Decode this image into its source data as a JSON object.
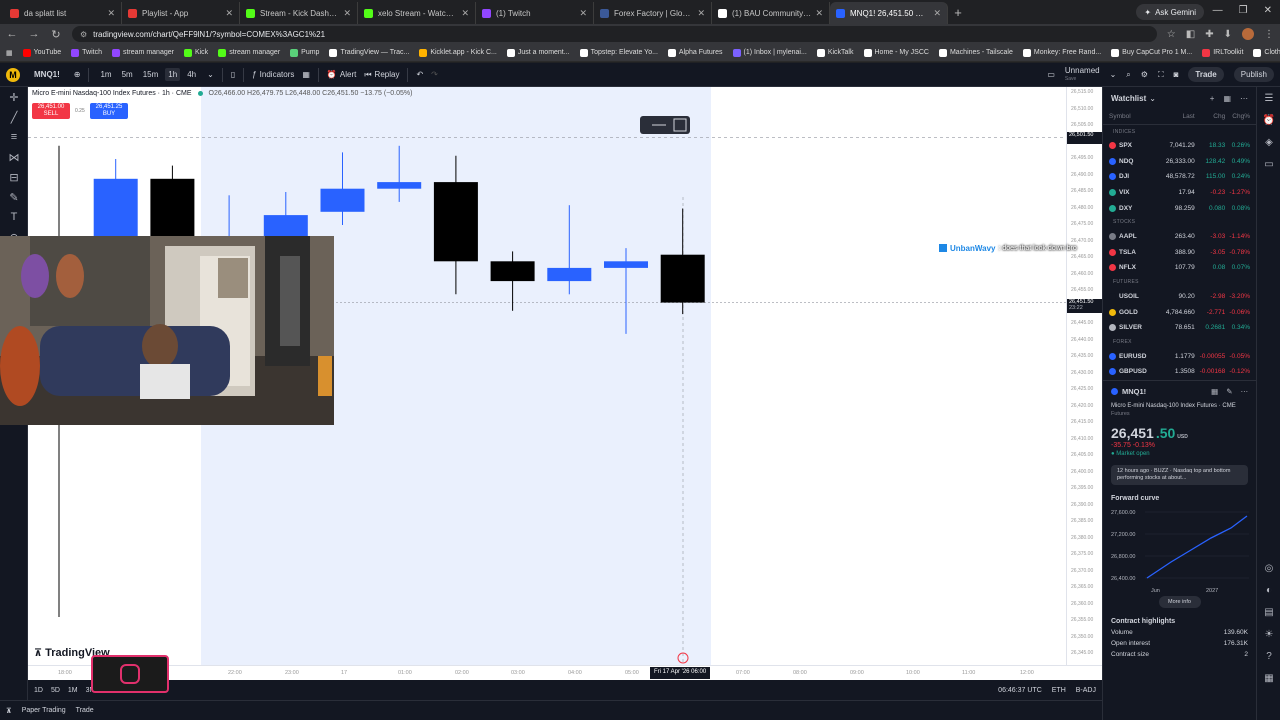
{
  "browser": {
    "tabs": [
      {
        "label": "da splatt list",
        "color": "#e53935",
        "active": false
      },
      {
        "label": "Playlist - App",
        "color": "#e53935",
        "active": false
      },
      {
        "label": "Stream - Kick Dashboard",
        "color": "#53fc18",
        "active": false
      },
      {
        "label": "xelo Stream - Watch Live on Ki",
        "color": "#53fc18",
        "active": false
      },
      {
        "label": "(1) Twitch",
        "color": "#9146ff",
        "active": false
      },
      {
        "label": "Forex Factory | Global markets",
        "color": "#3b5998",
        "active": false
      },
      {
        "label": "(1) BAU Community / X",
        "color": "#ffffff",
        "active": false
      },
      {
        "label": "MNQ1! 26,451.50 ▼ −0.13% U",
        "color": "#2962ff",
        "active": true
      }
    ],
    "new_tab": "+",
    "gemini_label": "Ask Gemini",
    "url": "tradingview.com/chart/QeFF9lN1/?symbol=COMEX%3AGC1%21",
    "bookmarks": [
      {
        "label": "YouTube",
        "color": "#ff0000"
      },
      {
        "label": "Twitch",
        "color": "#9146ff"
      },
      {
        "label": "stream manager",
        "color": "#9146ff"
      },
      {
        "label": "Kick",
        "color": "#53fc18"
      },
      {
        "label": "stream manager",
        "color": "#53fc18"
      },
      {
        "label": "Pump",
        "color": "#5ad07a"
      },
      {
        "label": "TradingView — Trac...",
        "color": "#ffffff"
      },
      {
        "label": "Kicklet.app - Kick C...",
        "color": "#ffb300"
      },
      {
        "label": "Just a moment...",
        "color": "#ffffff"
      },
      {
        "label": "Topstep: Elevate Yo...",
        "color": "#ffffff"
      },
      {
        "label": "Alpha Futures",
        "color": "#ffffff"
      },
      {
        "label": "(1) Inbox | mylenai...",
        "color": "#7b61ff"
      },
      {
        "label": "KickTalk",
        "color": "#ffffff"
      },
      {
        "label": "Home - My JSCC",
        "color": "#ffffff"
      },
      {
        "label": "Machines - Tailscale",
        "color": "#ffffff"
      },
      {
        "label": "Monkey: Free Rand...",
        "color": "#ffffff"
      },
      {
        "label": "Buy CapCut Pro 1 M...",
        "color": "#ffffff"
      },
      {
        "label": "IRLToolkit",
        "color": "#f23645"
      },
      {
        "label": "Clothing Preview | D...",
        "color": "#ffffff"
      }
    ]
  },
  "tv": {
    "symbol": "MNQ1!",
    "timeframes": [
      "1m",
      "5m",
      "15m",
      "1h",
      "4h"
    ],
    "active_tf": "1h",
    "indicators": "Indicators",
    "alert": "Alert",
    "replay": "Replay",
    "layout_name": "Unnamed",
    "layout_sub": "Save",
    "trade": "Trade",
    "publish": "Publish"
  },
  "chart": {
    "title": "Micro E-mini Nasdaq-100 Index Futures · 1h · CME",
    "ohlc": "O26,466.00 H26,479.75 L26,448.00 C26,451.50 −13.75 (−0.05%)",
    "sell_price": "26,451.00",
    "sell_label": "SELL",
    "buy_price": "26,451.25",
    "buy_label": "BUY",
    "spread": "0.25",
    "watermark": "TradingView",
    "price_labels": [
      "26,515.00",
      "26,510.00",
      "26,505.00",
      "26,500.00",
      "26,495.00",
      "26,490.00",
      "26,485.00",
      "26,480.00",
      "26,475.00",
      "26,470.00",
      "26,465.00",
      "26,460.00",
      "26,455.00",
      "26,450.00",
      "26,445.00",
      "26,440.00",
      "26,435.00",
      "26,430.00",
      "26,425.00",
      "26,420.00",
      "26,415.00",
      "26,410.00",
      "26,405.00",
      "26,400.00",
      "26,395.00",
      "26,390.00",
      "26,385.00",
      "26,380.00",
      "26,375.00",
      "26,370.00",
      "26,365.00",
      "26,360.00",
      "26,355.00",
      "26,350.00",
      "26,345.00",
      "26,340.00"
    ],
    "crosshair_price": "26,501.50",
    "last_price": "26,451.50",
    "countdown": "23:22",
    "time_labels": [
      "18:00",
      "22:00",
      "23:00",
      "17",
      "01:00",
      "02:00",
      "03:00",
      "04:00",
      "05:00",
      "07:00",
      "08:00",
      "09:00",
      "10:00",
      "11:00",
      "12:00"
    ],
    "time_cursor": "Fri 17 Apr '26  06:00",
    "candles": [
      {
        "o": 26463,
        "h": 26499,
        "l": 26338,
        "c": 26465,
        "visible_low": false
      },
      {
        "o": 26463,
        "h": 26495,
        "l": 26463,
        "c": 26489,
        "color": "blue"
      },
      {
        "o": 26489,
        "h": 26493,
        "l": 26463,
        "c": 26463,
        "color": "black"
      },
      {
        "o": 26466,
        "h": 26484,
        "l": 26466,
        "c": 26470,
        "color": "blue"
      },
      {
        "o": 26470,
        "h": 26485,
        "l": 26466,
        "c": 26478,
        "color": "blue"
      },
      {
        "o": 26479,
        "h": 26497,
        "l": 26475,
        "c": 26486,
        "color": "blue"
      },
      {
        "o": 26486,
        "h": 26499,
        "l": 26482,
        "c": 26488,
        "color": "blue"
      },
      {
        "o": 26488,
        "h": 26496,
        "l": 26454,
        "c": 26464,
        "color": "black"
      },
      {
        "o": 26464,
        "h": 26467,
        "l": 26449,
        "c": 26458,
        "color": "black"
      },
      {
        "o": 26458,
        "h": 26481,
        "l": 26454,
        "c": 26462,
        "color": "blue"
      },
      {
        "o": 26462,
        "h": 26468,
        "l": 26442,
        "c": 26464,
        "color": "blue"
      },
      {
        "o": 26466,
        "h": 26480,
        "l": 26448,
        "c": 26451.5,
        "color": "black"
      }
    ],
    "chat_user": "UnbanWavy",
    "chat_msg": ": does that look down bro"
  },
  "bottom": {
    "ranges": [
      "1D",
      "5D",
      "1M",
      "3M"
    ],
    "clock": "06:46:37 UTC",
    "session": "ETH",
    "adj": "B-ADJ"
  },
  "footer": {
    "paper": "Paper Trading",
    "trade": "Trade"
  },
  "watchlist": {
    "title": "Watchlist",
    "cols": [
      "Symbol",
      "Last",
      "Chg",
      "Chg%"
    ],
    "sections": [
      {
        "name": "INDICES",
        "rows": [
          {
            "sym": "SPX",
            "last": "7,041.29",
            "chg": "18.33",
            "pct": "0.26%",
            "dir": "pos",
            "dot": "#f23645"
          },
          {
            "sym": "NDQ",
            "last": "26,333.00",
            "chg": "128.42",
            "pct": "0.49%",
            "dir": "pos",
            "dot": "#2962ff"
          },
          {
            "sym": "DJI",
            "last": "48,578.72",
            "chg": "115.00",
            "pct": "0.24%",
            "dir": "pos",
            "dot": "#2962ff"
          },
          {
            "sym": "VIX",
            "last": "17.94",
            "chg": "-0.23",
            "pct": "-1.27%",
            "dir": "neg",
            "dot": "#22ab94"
          },
          {
            "sym": "DXY",
            "last": "98.259",
            "chg": "0.080",
            "pct": "0.08%",
            "dir": "pos",
            "dot": "#22ab94"
          }
        ]
      },
      {
        "name": "STOCKS",
        "rows": [
          {
            "sym": "AAPL",
            "last": "263.40",
            "chg": "-3.03",
            "pct": "-1.14%",
            "dir": "neg",
            "dot": "#787b86"
          },
          {
            "sym": "TSLA",
            "last": "388.90",
            "chg": "-3.05",
            "pct": "-0.78%",
            "dir": "neg",
            "dot": "#f23645"
          },
          {
            "sym": "NFLX",
            "last": "107.79",
            "chg": "0.08",
            "pct": "0.07%",
            "dir": "pos",
            "dot": "#f23645"
          }
        ]
      },
      {
        "name": "FUTURES",
        "rows": [
          {
            "sym": "USOIL",
            "last": "90.20",
            "chg": "-2.98",
            "pct": "-3.20%",
            "dir": "neg",
            "dot": "#131722"
          },
          {
            "sym": "GOLD",
            "last": "4,784.660",
            "chg": "-2.771",
            "pct": "-0.06%",
            "dir": "neg",
            "dot": "#f0b90b"
          },
          {
            "sym": "SILVER",
            "last": "78.651",
            "chg": "0.2681",
            "pct": "0.34%",
            "dir": "pos",
            "dot": "#b2b5be"
          }
        ]
      },
      {
        "name": "FOREX",
        "rows": [
          {
            "sym": "EURUSD",
            "last": "1.1779",
            "chg": "-0.00055",
            "pct": "-0.05%",
            "dir": "neg",
            "dot": "#2962ff"
          },
          {
            "sym": "GBPUSD",
            "last": "1.3508",
            "chg": "-0.00168",
            "pct": "-0.12%",
            "dir": "neg",
            "dot": "#2962ff"
          }
        ]
      }
    ]
  },
  "detail": {
    "symbol": "MNQ1!",
    "name": "Micro E-mini Nasdaq-100 Index Futures · CME",
    "sub": "Futures",
    "price_main": "26,451",
    "price_frac": ".50",
    "currency": "USD",
    "change": "-35.75  -0.13%",
    "market": "● Market open",
    "news": "12 hours ago · BUZZ · Nasdaq top and bottom performing stocks at about...",
    "forward_title": "Forward curve",
    "forward_ylabels": [
      "27,600.00",
      "27,200.00",
      "26,800.00",
      "26,400.00"
    ],
    "forward_xlabels": [
      "Jun",
      "2027"
    ],
    "more_info": "More info",
    "contracts_title": "Contract highlights",
    "contracts": [
      {
        "k": "Volume",
        "v": "139.60K"
      },
      {
        "k": "Open interest",
        "v": "176.31K"
      },
      {
        "k": "Contract size",
        "v": "2"
      }
    ]
  }
}
